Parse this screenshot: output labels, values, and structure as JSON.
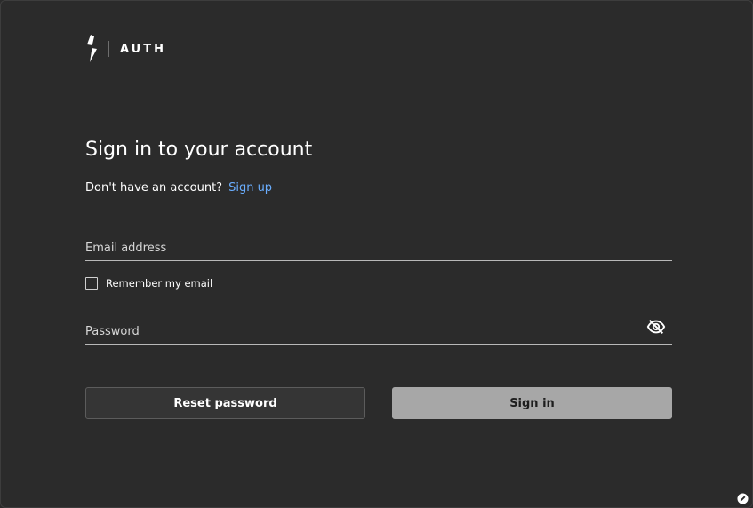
{
  "brand": {
    "name": "AUTH"
  },
  "form": {
    "title": "Sign in to your account",
    "no_account_text": "Don't have an account?",
    "signup_label": "Sign up",
    "email_placeholder": "Email address",
    "remember_label": "Remember my email",
    "password_placeholder": "Password",
    "reset_label": "Reset password",
    "signin_label": "Sign in"
  },
  "icons": {
    "logo": "bolt-logo-icon",
    "password_toggle": "eye-off-icon",
    "corner": "edit-badge-icon"
  },
  "colors": {
    "background": "#2b2b2b",
    "link": "#6aaeff",
    "primary_button": "#a7a7a7",
    "secondary_button": "#353535"
  }
}
